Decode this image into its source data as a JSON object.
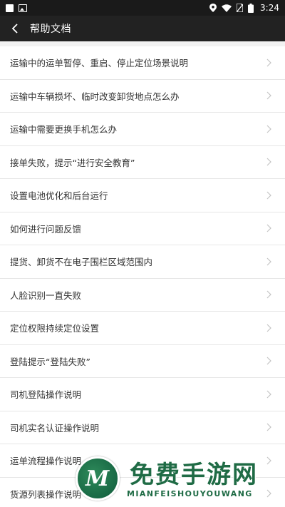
{
  "status_bar": {
    "time": "3:24"
  },
  "header": {
    "title": "帮助文档"
  },
  "help_items": [
    {
      "label": "运输中的运单暂停、重启、停止定位场景说明"
    },
    {
      "label": "运输中车辆损坏、临时改变卸货地点怎么办"
    },
    {
      "label": "运输中需要更换手机怎么办"
    },
    {
      "label": "接单失败，提示“进行安全教育”"
    },
    {
      "label": "设置电池优化和后台运行"
    },
    {
      "label": "如何进行问题反馈"
    },
    {
      "label": "提货、卸货不在电子围栏区域范围内"
    },
    {
      "label": "人脸识别一直失败"
    },
    {
      "label": "定位权限持续定位设置"
    },
    {
      "label": "登陆提示“登陆失败”"
    },
    {
      "label": "司机登陆操作说明"
    },
    {
      "label": "司机实名认证操作说明"
    },
    {
      "label": "运单流程操作说明"
    },
    {
      "label": "货源列表操作说明"
    }
  ],
  "watermark": {
    "title": "免费手游网",
    "subtitle": "MIANFEISHOUYOUWANG"
  },
  "colors": {
    "appbar": "#222222",
    "statusbar": "#1a1a1a",
    "list_bg": "#ffffff",
    "page_bg": "#f2f2f2",
    "watermark": "#1f6b45"
  }
}
